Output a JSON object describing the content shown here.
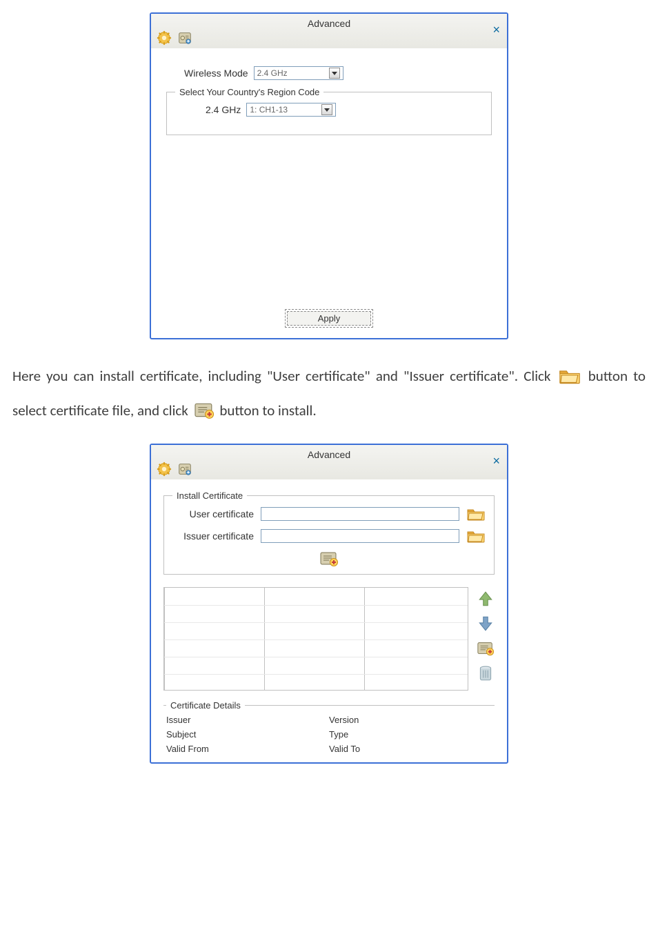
{
  "dialog1": {
    "title": "Advanced",
    "wireless_mode_label": "Wireless Mode",
    "wireless_mode_value": "2.4 GHz",
    "region_group_title": "Select Your Country's Region Code",
    "region_24_label": "2.4 GHz",
    "region_24_value": "1: CH1-13",
    "apply_label": "Apply"
  },
  "paragraph": {
    "t1": "Here you can install certificate, including \"User certificate\" and \"Issuer certificate\". Click ",
    "t2": " button to select certificate file, and click ",
    "t3": " button to install."
  },
  "dialog2": {
    "title": "Advanced",
    "group_title": "Install Certificate",
    "user_cert_label": "User certificate",
    "issuer_cert_label": "Issuer certificate",
    "details_group_title": "Certificate Details",
    "details": {
      "issuer": "Issuer",
      "version": "Version",
      "subject": "Subject",
      "type": "Type",
      "valid_from": "Valid From",
      "valid_to": "Valid To"
    }
  }
}
